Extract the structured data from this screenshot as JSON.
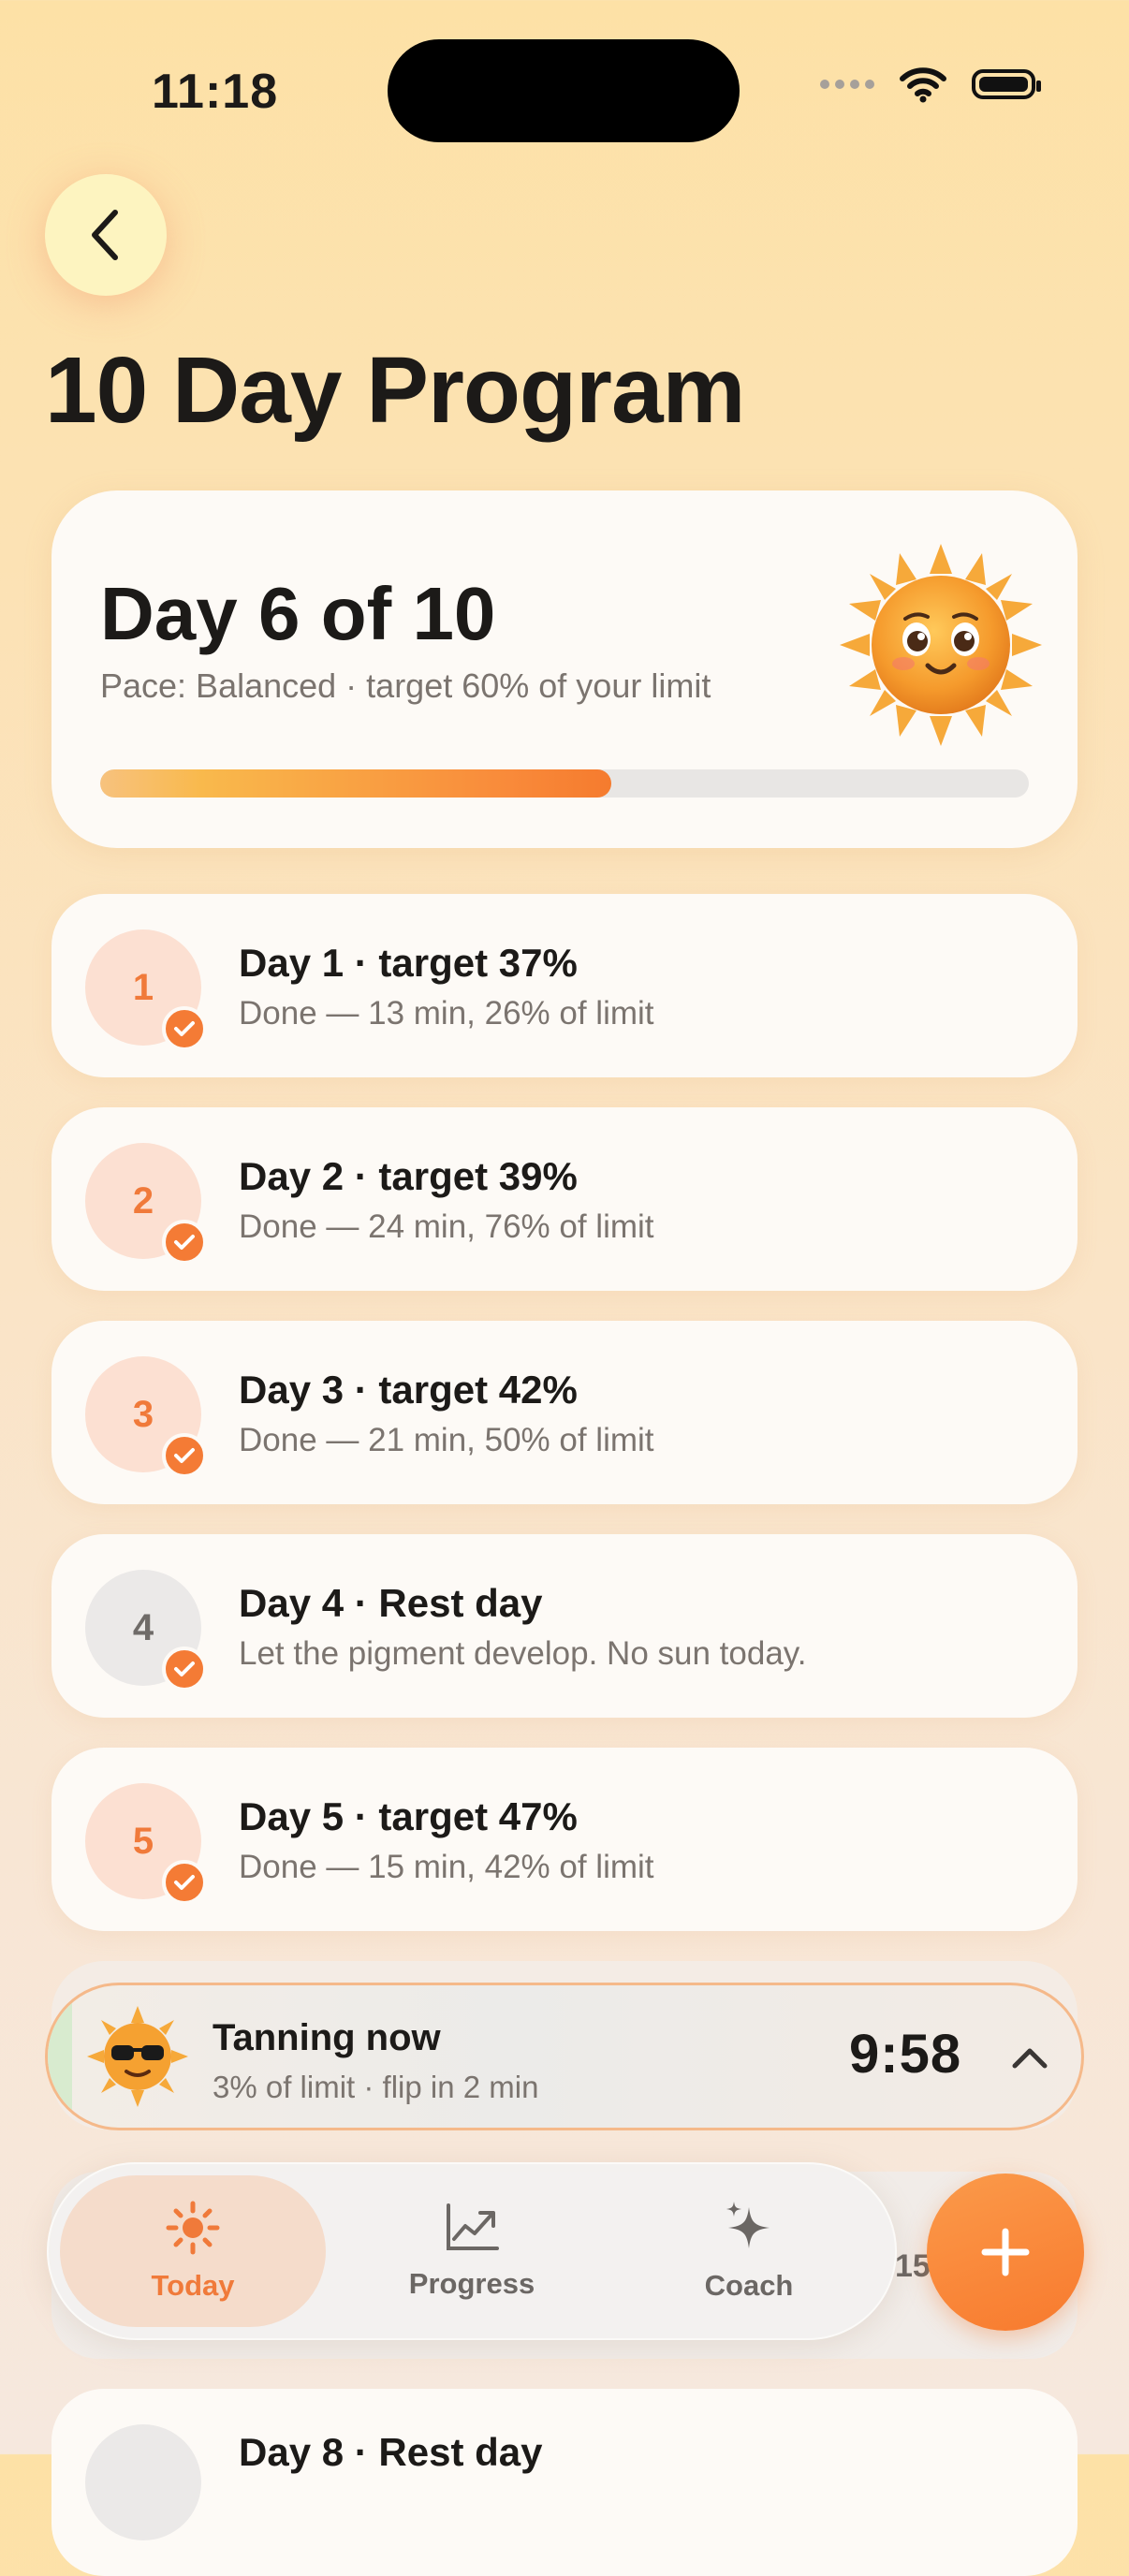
{
  "status_bar": {
    "time": "11:18"
  },
  "page": {
    "title": "10 Day Program"
  },
  "summary": {
    "title": "Day 6 of 10",
    "subtitle": "Pace: Balanced · target 60% of your limit",
    "progress_percent": 55
  },
  "days": [
    {
      "num": "1",
      "title": "Day 1 · target 37%",
      "subtitle": "Done — 13 min, 26% of limit",
      "rest": false,
      "done": true
    },
    {
      "num": "2",
      "title": "Day 2 · target 39%",
      "subtitle": "Done — 24 min, 76% of limit",
      "rest": false,
      "done": true
    },
    {
      "num": "3",
      "title": "Day 3 · target 42%",
      "subtitle": "Done — 21 min, 50% of limit",
      "rest": false,
      "done": true
    },
    {
      "num": "4",
      "title": "Day 4 · Rest day",
      "subtitle": "Let the pigment develop. No sun today.",
      "rest": true,
      "done": true
    },
    {
      "num": "5",
      "title": "Day 5 · target 47%",
      "subtitle": "Done — 15 min, 42% of limit",
      "rest": false,
      "done": true
    }
  ],
  "tanning": {
    "title": "Tanning now",
    "subtitle": "3% of limit · flip in 2 min",
    "timer": "9:58"
  },
  "tabs": [
    {
      "label": "Today",
      "icon": "sun-icon",
      "active": true
    },
    {
      "label": "Progress",
      "icon": "chart-icon",
      "active": false
    },
    {
      "label": "Coach",
      "icon": "sparkle-icon",
      "active": false
    }
  ],
  "peek_text": "15",
  "bottom_card": {
    "title": "Day 8 · Rest day"
  },
  "colors": {
    "accent": "#f47b35",
    "card": "#fdfaf6",
    "muted_text": "#7b746f"
  }
}
